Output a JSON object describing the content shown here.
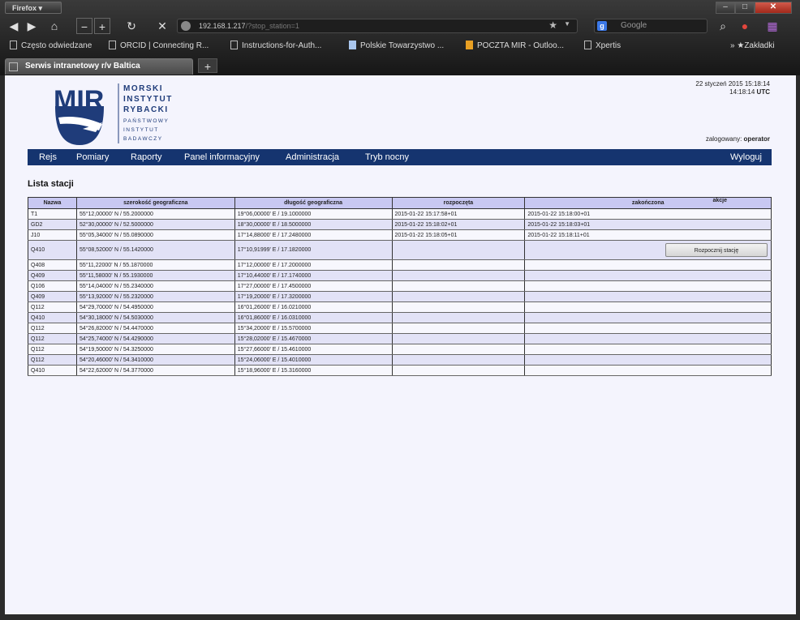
{
  "browser": {
    "app_button": "Firefox",
    "url": "192.168.1.217",
    "url_path": "/?stop_station=1",
    "search_placeholder": "Google",
    "bookmarks": [
      "Często odwiedzane",
      "ORCID | Connecting R...",
      "Instructions-for-Auth...",
      "Polskie Towarzystwo ...",
      "POCZTA MIR - Outloo...",
      "Xpertis"
    ],
    "bookmarks_menu": "Zakładki",
    "tab_title": "Serwis intranetowy r/v Baltica",
    "new_tab": "+"
  },
  "header": {
    "logo": {
      "mark": "MIR",
      "lines": [
        "MORSKI",
        "INSTYTUT",
        "RYBACKI",
        "PAŃSTWOWY",
        "INSTYTUT",
        "BADAWCZY"
      ]
    },
    "date_line": "22 styczeń 2015 15:18:14",
    "utc_time": "14:18:14",
    "utc_label": "UTC",
    "logged_label": "zalogowany:",
    "logged_user": "operator"
  },
  "menu": {
    "items": [
      "Rejs",
      "Pomiary",
      "Raporty",
      "Panel informacyjny",
      "Administracja",
      "Tryb nocny"
    ],
    "logout": "Wyloguj"
  },
  "page_title": "Lista stacji",
  "table": {
    "headers": {
      "name": "Nazwa",
      "lat": "szerokość geograficzna",
      "lon": "długość geograficzna",
      "start": "rozpoczęta",
      "end": "zakończona",
      "actions": "akcje"
    },
    "action_button": "Rozpocznij stację",
    "rows": [
      {
        "name": "T1",
        "lat": "55°12,00000' N / 55.2000000",
        "lon": "19°06,00000' E / 19.1000000",
        "start": "2015-01-22 15:17:58+01",
        "end": "2015-01-22 15:18:00+01"
      },
      {
        "name": "GD2",
        "lat": "52°30,00000' N / 52.5000000",
        "lon": "18°30,00000' E / 18.5000000",
        "start": "2015-01-22 15:18:02+01",
        "end": "2015-01-22 15:18:03+01"
      },
      {
        "name": "J10",
        "lat": "55°05,34000' N / 55.0890000",
        "lon": "17°14,88000' E / 17.2480000",
        "start": "2015-01-22 15:18:05+01",
        "end": "2015-01-22 15:18:11+01"
      },
      {
        "name": "Q410",
        "lat": "55°08,52000' N / 55.1420000",
        "lon": "17°10,91999' E / 17.1820000",
        "start": "",
        "end": "",
        "button": true
      },
      {
        "name": "Q408",
        "lat": "55°11,22000' N / 55.1870000",
        "lon": "17°12,00000' E / 17.2000000",
        "start": "",
        "end": ""
      },
      {
        "name": "Q409",
        "lat": "55°11,58000' N / 55.1930000",
        "lon": "17°10,44000' E / 17.1740000",
        "start": "",
        "end": ""
      },
      {
        "name": "Q106",
        "lat": "55°14,04000' N / 55.2340000",
        "lon": "17°27,00000' E / 17.4500000",
        "start": "",
        "end": ""
      },
      {
        "name": "Q409",
        "lat": "55°13,92000' N / 55.2320000",
        "lon": "17°19,20000' E / 17.3200000",
        "start": "",
        "end": ""
      },
      {
        "name": "Q112",
        "lat": "54°29,70000' N / 54.4950000",
        "lon": "16°01,26000' E / 16.0210000",
        "start": "",
        "end": ""
      },
      {
        "name": "Q410",
        "lat": "54°30,18000' N / 54.5030000",
        "lon": "16°01,86000' E / 16.0310000",
        "start": "",
        "end": ""
      },
      {
        "name": "Q112",
        "lat": "54°26,82000' N / 54.4470000",
        "lon": "15°34,20000' E / 15.5700000",
        "start": "",
        "end": ""
      },
      {
        "name": "Q112",
        "lat": "54°25,74000' N / 54.4290000",
        "lon": "15°28,02000' E / 15.4670000",
        "start": "",
        "end": ""
      },
      {
        "name": "Q112",
        "lat": "54°19,50000' N / 54.3250000",
        "lon": "15°27,66000' E / 15.4610000",
        "start": "",
        "end": ""
      },
      {
        "name": "Q112",
        "lat": "54°20,46000' N / 54.3410000",
        "lon": "15°24,06000' E / 15.4010000",
        "start": "",
        "end": ""
      },
      {
        "name": "Q410",
        "lat": "54°22,62000' N / 54.3770000",
        "lon": "15°18,96000' E / 15.3160000",
        "start": "",
        "end": ""
      }
    ]
  },
  "colors": {
    "menu_bg": "#15346f",
    "table_header_bg": "#c8c8f2",
    "page_bg": "#f4f4fd",
    "logo_blue": "#1f3c7a"
  }
}
